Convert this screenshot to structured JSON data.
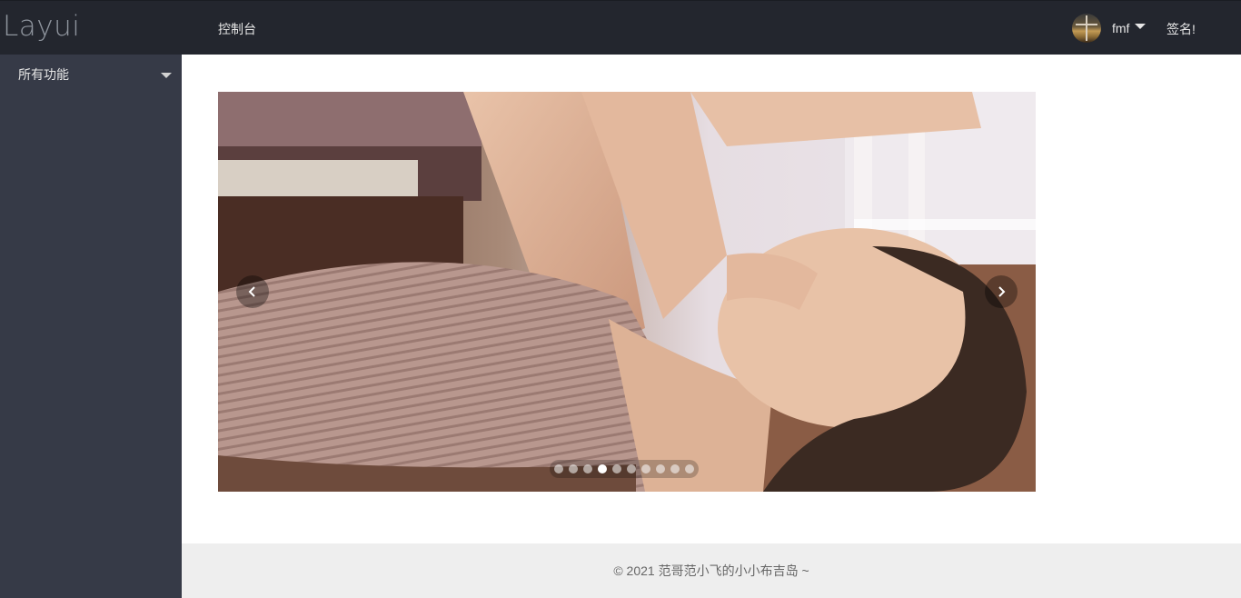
{
  "header": {
    "logo": "Layui",
    "nav_console": "控制台",
    "user_name": "fmf",
    "signature": "签名!"
  },
  "sidebar": {
    "items": [
      {
        "label": "所有功能"
      }
    ]
  },
  "carousel": {
    "slide_count": 10,
    "active_index": 3,
    "prev_icon": "chevron-left-icon",
    "next_icon": "chevron-right-icon"
  },
  "footer": {
    "text": "© 2021 范哥范小飞的小小布吉岛 ~"
  },
  "colors": {
    "header_bg": "#23262e",
    "sidebar_bg": "#363a47",
    "footer_bg": "#eeeeee"
  }
}
